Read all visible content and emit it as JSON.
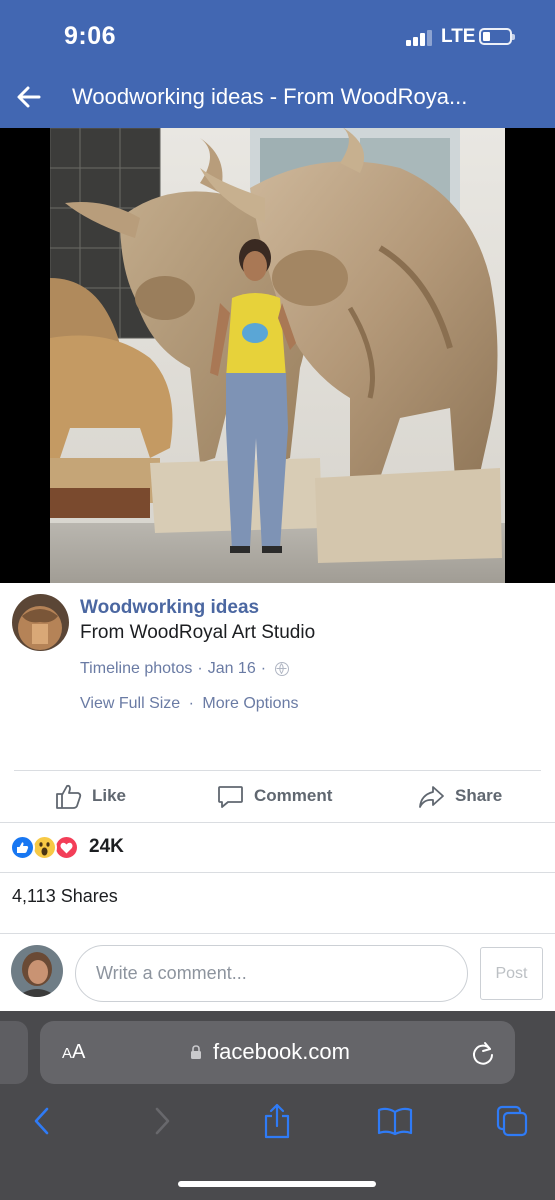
{
  "status_bar": {
    "time": "9:06",
    "network": "LTE"
  },
  "header": {
    "back_icon": "back-arrow-icon",
    "title": "Woodworking ideas - From WoodRoya..."
  },
  "photo": {
    "description_icon": "photo"
  },
  "post": {
    "page_name": "Woodworking ideas",
    "subtitle": "From WoodRoyal Art Studio",
    "album": "Timeline photos",
    "date": "Jan 16",
    "separator": "·",
    "view_full_size": "View Full Size",
    "more_options": "More Options"
  },
  "actions": {
    "like": "Like",
    "comment": "Comment",
    "share": "Share"
  },
  "reactions": {
    "count": "24K",
    "types": [
      "like",
      "wow",
      "love"
    ]
  },
  "shares": {
    "text": "4,113 Shares"
  },
  "composer": {
    "placeholder": "Write a comment...",
    "post_label": "Post"
  },
  "browser": {
    "text_size_small": "A",
    "text_size_big": "A",
    "domain": "facebook.com"
  },
  "colors": {
    "facebook_blue": "#4267b2",
    "link_blue": "#4b67a1",
    "safari_bar": "#4a4a4d",
    "ios_blue": "#2f7bf6"
  }
}
